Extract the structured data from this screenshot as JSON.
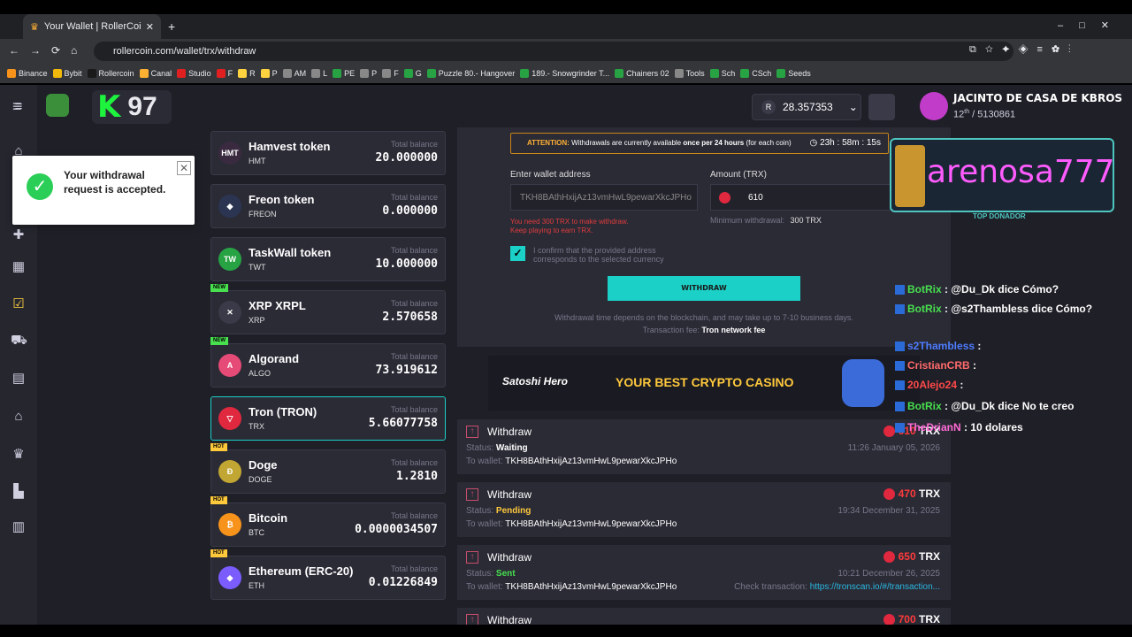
{
  "browser": {
    "tab_title": "Your Wallet | RollerCoin.com | W",
    "url": "rollercoin.com/wallet/trx/withdraw",
    "bookmarks": [
      "Binance",
      "Bybit",
      "Rollercoin",
      "Canal",
      "Studio",
      "F",
      "R",
      "P",
      "AM",
      "L",
      "PE",
      "P",
      "F",
      "G",
      "Puzzle 80.- Hangover",
      "189.- Snowgrinder T...",
      "Chainers 02",
      "Tools",
      "Sch",
      "CSch",
      "Seeds"
    ]
  },
  "header": {
    "level": "97",
    "level_letter": "K",
    "balance": "28.357353",
    "balance_symbol": "R",
    "user_name": "JACINTO DE CASA DE KBROS",
    "rank": "12",
    "rank_sup": "th",
    "rank_total": " / 5130861"
  },
  "toast": {
    "message": "Your withdrawal request is accepted."
  },
  "coins": [
    {
      "name": "Hamvest token",
      "symbol": "HMT",
      "total_label": "Total balance",
      "value": "20.000000",
      "icon": "HMT",
      "color": "#3a2a40",
      "badge": ""
    },
    {
      "name": "Freon token",
      "symbol": "FREON",
      "total_label": "Total balance",
      "value": "0.000000",
      "icon": "◆",
      "color": "#2b3552",
      "badge": ""
    },
    {
      "name": "TaskWall token",
      "symbol": "TWT",
      "total_label": "Total balance",
      "value": "10.000000",
      "icon": "TW",
      "color": "#27a344",
      "badge": ""
    },
    {
      "name": "XRP XRPL",
      "symbol": "XRP",
      "total_label": "Total balance",
      "value": "2.570658",
      "icon": "✕",
      "color": "#3a3a48",
      "badge": "NEW"
    },
    {
      "name": "Algorand",
      "symbol": "ALGO",
      "total_label": "Total balance",
      "value": "73.919612",
      "icon": "A",
      "color": "#e64a77",
      "badge": "NEW"
    },
    {
      "name": "Tron (TRON)",
      "symbol": "TRX",
      "total_label": "Total balance",
      "value": "5.66077758",
      "icon": "▽",
      "color": "#e0283e",
      "badge": "",
      "selected": true
    },
    {
      "name": "Doge",
      "symbol": "DOGE",
      "total_label": "Total balance",
      "value": "1.2810",
      "icon": "Ð",
      "color": "#c2a633",
      "badge": "HOT"
    },
    {
      "name": "Bitcoin",
      "symbol": "BTC",
      "total_label": "Total balance",
      "value": "0.0000034507",
      "icon": "₿",
      "color": "#f7931a",
      "badge": "HOT"
    },
    {
      "name": "Ethereum (ERC-20)",
      "symbol": "ETH",
      "total_label": "Total balance",
      "value": "0.01226849",
      "icon": "◆",
      "color": "#7b5cff",
      "badge": "HOT"
    }
  ],
  "form": {
    "attention_label": "ATTENTION:",
    "attention_text": " Withdrawals are currently available ",
    "attention_bold": "once per 24 hours",
    "attention_tail": " (for each coin)",
    "timer": "23h : 58m : 15s",
    "address_label": "Enter wallet address",
    "address_value": "TKH8BAthHxijAz13vmHwL9pewarXkcJPHo",
    "amount_label": "Amount (TRX)",
    "amount_value": "610",
    "error1": "You need 300 TRX to make withdraw.",
    "error2": "Keep playing to earn TRX.",
    "minimum_label": "Minimum withdrawal:",
    "minimum_value": "300 TRX",
    "confirm_text": "I confirm that the provided address corresponds to the selected currency",
    "button": "WITHDRAW",
    "note1": "Withdrawal time depends on the blockchain, and may take up to 7-10 business days.",
    "fee_label": "Transaction fee:",
    "fee_value": "Tron network fee"
  },
  "banner": {
    "brand": "Satoshi Hero",
    "slogan": "YOUR BEST CRYPTO CASINO"
  },
  "withdrawals": [
    {
      "title": "Withdraw",
      "status_label": "Status:",
      "status": "Waiting",
      "status_color": "#ffffff",
      "wallet_label": "To wallet:",
      "wallet": "TKH8BAthHxijAz13vmHwL9pewarXkcJPHo",
      "amount": "610",
      "unit": "TRX",
      "date": "11:26 January 05, 2026",
      "check_label": "",
      "check_link": ""
    },
    {
      "title": "Withdraw",
      "status_label": "Status:",
      "status": "Pending",
      "status_color": "#ffc93c",
      "wallet_label": "To wallet:",
      "wallet": "TKH8BAthHxijAz13vmHwL9pewarXkcJPHo",
      "amount": "470",
      "unit": "TRX",
      "date": "19:34 December 31, 2025",
      "check_label": "",
      "check_link": ""
    },
    {
      "title": "Withdraw",
      "status_label": "Status:",
      "status": "Sent",
      "status_color": "#48e04f",
      "wallet_label": "To wallet:",
      "wallet": "TKH8BAthHxijAz13vmHwL9pewarXkcJPHo",
      "amount": "650",
      "unit": "TRX",
      "date": "10:21 December 26, 2025",
      "check_label": "Check transaction:",
      "check_link": "https://tronscan.io/#/transaction..."
    },
    {
      "title": "Withdraw",
      "amount": "700",
      "unit": "TRX"
    }
  ],
  "stream": {
    "name": "arenosa777",
    "label": "TOP DONADOR"
  },
  "chat": [
    {
      "user": "BotRix",
      "msg": " : @Du_Dk dice Cómo?",
      "color": "#48e04f"
    },
    {
      "user": "BotRix",
      "msg": " : @s2Thambless dice Cómo?",
      "color": "#48e04f"
    },
    {
      "user": "s2Thambless",
      "msg": " : ",
      "color": "#4d7cff"
    },
    {
      "user": "CristianCRB",
      "msg": " : ",
      "color": "#ff6b6b"
    },
    {
      "user": "20Alejo24",
      "msg": " : ",
      "color": "#ff4a4a"
    },
    {
      "user": "BotRix",
      "msg": " : @Du_Dk dice No te creo",
      "color": "#48e04f"
    },
    {
      "user": "TheDrianN",
      "msg": " : 10 dolares",
      "color": "#ff6bd6"
    }
  ]
}
